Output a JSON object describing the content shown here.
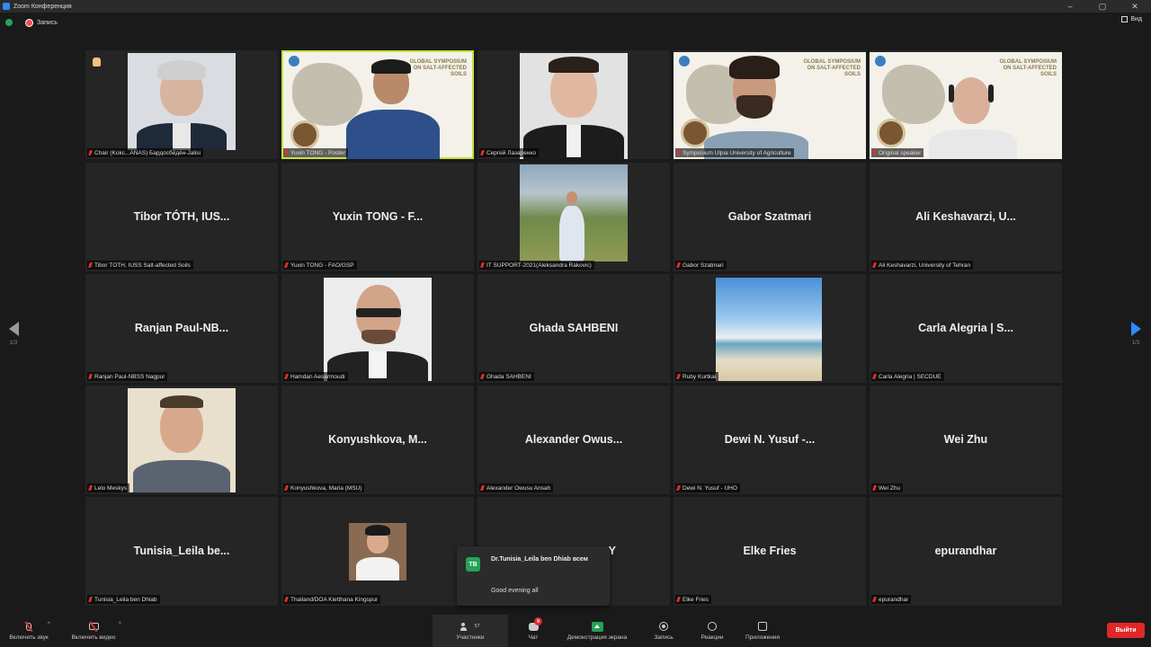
{
  "window": {
    "title": "Zoom Конференция"
  },
  "info": {
    "recording": "Запись",
    "view": "Вид"
  },
  "nav": {
    "left_page": "1/3",
    "right_page": "1/3"
  },
  "tiles": [
    {
      "label": "Chair (Kokc...ANAS) Бардосбёдён-Jalisi",
      "big": ""
    },
    {
      "label": "Yuxin TONG - Poster",
      "big": ""
    },
    {
      "label": "Сергей Лазаренко",
      "big": ""
    },
    {
      "label": "Symposium Ulpia University of Agriculture",
      "big": ""
    },
    {
      "label": "Original speaker",
      "big": ""
    },
    {
      "label": "Tibor TÓTH, IUSS Salt-affected Soils",
      "big": "Tibor TÓTH, IUS..."
    },
    {
      "label": "Yuxin TONG - FAO/GSP",
      "big": "Yuxin TONG - F..."
    },
    {
      "label": "IT SUPPORT-2021(Aleksandra Rakovic)",
      "big": ""
    },
    {
      "label": "Gabor Szatmari",
      "big": "Gabor Szatmari"
    },
    {
      "label": "Ali Keshavarzi, University of Tehran",
      "big": "Ali Keshavarzi, U..."
    },
    {
      "label": "Ranjan Paul-NBSS Nagpur",
      "big": "Ranjan Paul-NB..."
    },
    {
      "label": "Hamdan Aesarmoudi",
      "big": ""
    },
    {
      "label": "Ghada SAHBENI",
      "big": "Ghada SAHBENI"
    },
    {
      "label": "Ruby Kurtkai",
      "big": ""
    },
    {
      "label": "Carla Alegria | SECDUE",
      "big": "Carla Alegria | S..."
    },
    {
      "label": "Lelo Meskys",
      "big": ""
    },
    {
      "label": "Konyushkova, Maria (MSU)",
      "big": "Konyushkova, M..."
    },
    {
      "label": "Alexander Owusu Ansah",
      "big": "Alexander Owus..."
    },
    {
      "label": "Dewi N. Yusuf - UHO",
      "big": "Dewi N. Yusuf -..."
    },
    {
      "label": "Wei Zhu",
      "big": "Wei Zhu"
    },
    {
      "label": "Tunisia_Leila ben Dhiab",
      "big": "Tunisia_Leila be..."
    },
    {
      "label": "Thailand/DOA Kietthana Kingspur",
      "big": ""
    },
    {
      "label": "",
      "big": "Y"
    },
    {
      "label": "Elke Fries",
      "big": "Elke Fries"
    },
    {
      "label": "epurandhar",
      "big": "epurandhar"
    }
  ],
  "slide": {
    "title": "GLOBAL SYMPOSIUM ON SALT-AFFECTED SOILS"
  },
  "chat_popup": {
    "avatar": "TB",
    "sender": "Dr.Tunisia_Leila ben Dhiab всем",
    "message": "Good evening all"
  },
  "toolbar": {
    "mute": "Включить звук",
    "video": "Включить видео",
    "participants": "Участники",
    "participants_count": "57",
    "chat": "Чат",
    "chat_badge": "9",
    "share": "Демонстрация экрана",
    "record": "Запись",
    "reactions": "Реакции",
    "apps": "Приложения",
    "leave": "Выйти"
  },
  "colors": {
    "active_speaker": "#c7e23a",
    "share_green": "#23a455",
    "leave_red": "#e02828",
    "zoom_blue": "#2d8cff"
  }
}
